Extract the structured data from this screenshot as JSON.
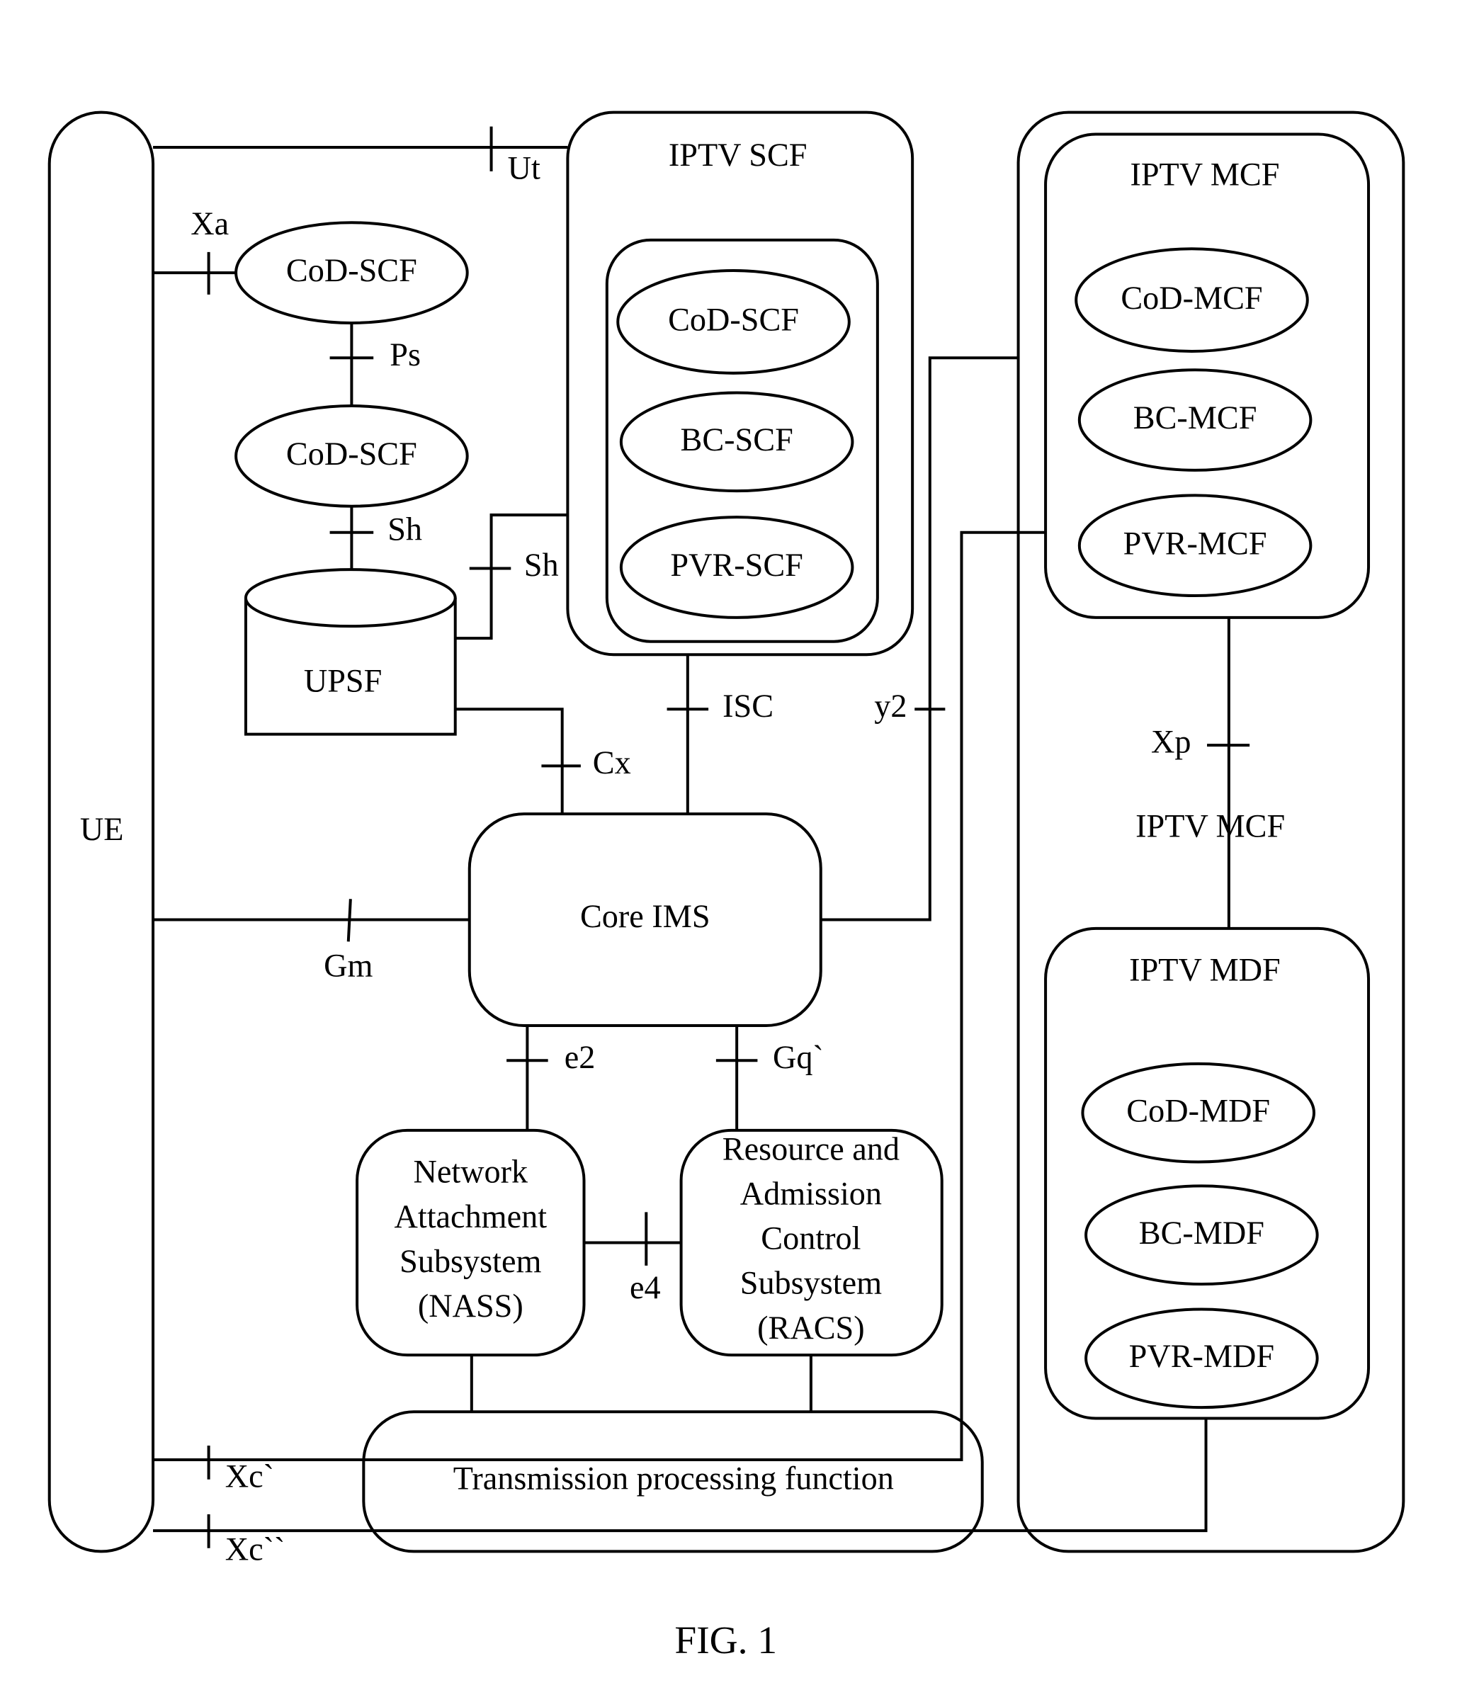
{
  "figure_caption": "FIG. 1",
  "nodes": {
    "ue": "UE",
    "iptv_scf": {
      "title": "IPTV SCF",
      "items": [
        "CoD-SCF",
        "BC-SCF",
        "PVR-SCF"
      ]
    },
    "standalone_scf": [
      "CoD-SCF",
      "CoD-SCF"
    ],
    "upsf": "UPSF",
    "core_ims": "Core IMS",
    "nass": [
      "Network",
      "Attachment",
      "Subsystem",
      "(NASS)"
    ],
    "racs": [
      "Resource and",
      "Admission",
      "Control",
      "Subsystem",
      "(RACS)"
    ],
    "transmission": "Transmission processing function",
    "iptv_mcf": {
      "title": "IPTV MCF",
      "items": [
        "CoD-MCF",
        "BC-MCF",
        "PVR-MCF"
      ]
    },
    "outer_mcf_label": "IPTV MCF",
    "iptv_mdf": {
      "title": "IPTV MDF",
      "items": [
        "CoD-MDF",
        "BC-MDF",
        "PVR-MDF"
      ]
    }
  },
  "interfaces": {
    "ut": "Ut",
    "xa": "Xa",
    "ps": "Ps",
    "sh1": "Sh",
    "sh2": "Sh",
    "cx": "Cx",
    "isc": "ISC",
    "y2": "y2",
    "gm": "Gm",
    "e2": "e2",
    "gq": "Gq`",
    "e4": "e4",
    "xp": "Xp",
    "xc1": "Xc`",
    "xc2": "Xc``"
  }
}
